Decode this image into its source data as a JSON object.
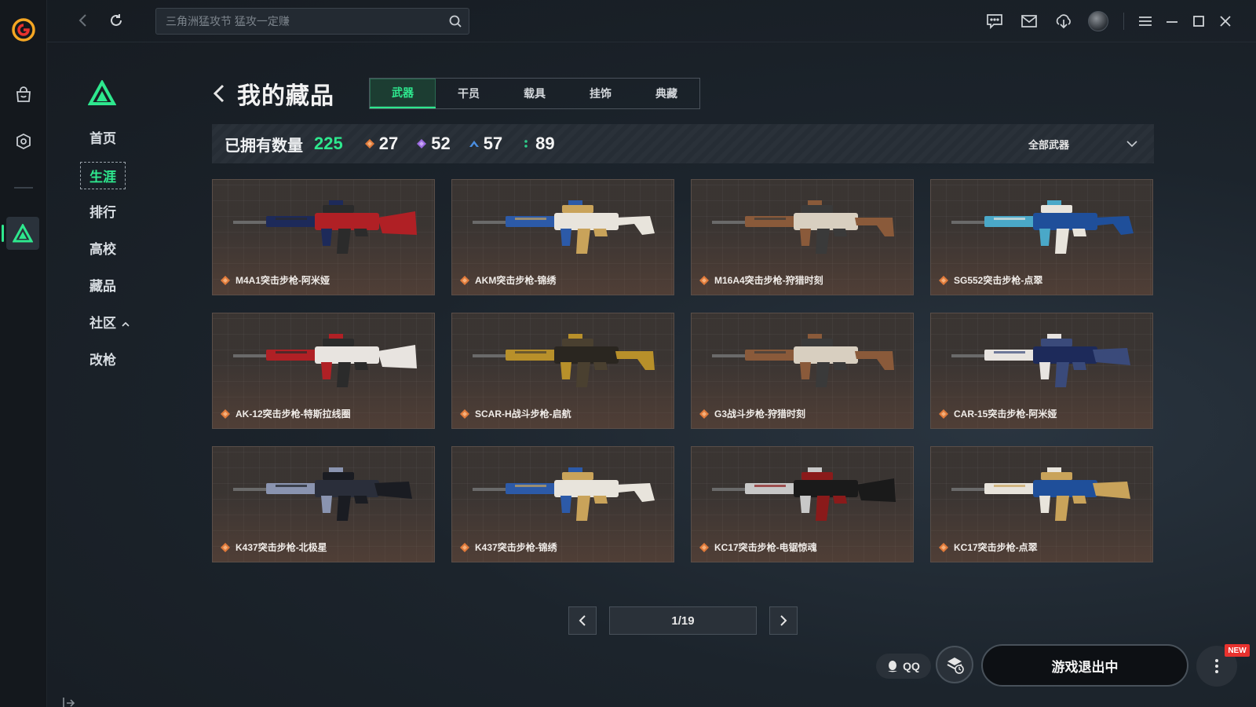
{
  "search": {
    "placeholder": "三角洲猛攻节 猛攻一定赚"
  },
  "subnav": {
    "items": [
      {
        "label": "首页",
        "active": false
      },
      {
        "label": "生涯",
        "active": true
      },
      {
        "label": "排行",
        "active": false
      },
      {
        "label": "高校",
        "active": false
      },
      {
        "label": "藏品",
        "active": false
      },
      {
        "label": "社区",
        "active": false,
        "expandable": true
      },
      {
        "label": "改枪",
        "active": false
      }
    ]
  },
  "page": {
    "title": "我的藏品"
  },
  "tabs": [
    {
      "label": "武器",
      "active": true
    },
    {
      "label": "干员",
      "active": false
    },
    {
      "label": "载具",
      "active": false
    },
    {
      "label": "挂饰",
      "active": false
    },
    {
      "label": "典藏",
      "active": false
    }
  ],
  "stats": {
    "owned_label": "已拥有数量",
    "owned_count": "225",
    "items": [
      {
        "value": "27",
        "color": "#e07a3a"
      },
      {
        "value": "52",
        "color": "#9b6ae0"
      },
      {
        "value": "57",
        "color": "#4a8ee0"
      },
      {
        "value": "89",
        "color": "#2ecc8a"
      }
    ],
    "filter_label": "全部武器"
  },
  "cards": [
    {
      "name": "M4A1突击步枪-阿米娅",
      "palette": [
        "#b02025",
        "#1d2a5a",
        "#2b2b2b"
      ]
    },
    {
      "name": "AKM突击步枪-锦绣",
      "palette": [
        "#e8e4dc",
        "#2c5aa8",
        "#c9a35a"
      ]
    },
    {
      "name": "M16A4突击步枪-狩猎时刻",
      "palette": [
        "#d8cfc0",
        "#8a5a3a",
        "#3a3a3a"
      ]
    },
    {
      "name": "SG552突击步枪-点翠",
      "palette": [
        "#1f4f9a",
        "#4aa8c8",
        "#e8e4dc"
      ]
    },
    {
      "name": "AK-12突击步枪-特斯拉线圈",
      "palette": [
        "#e8e4e0",
        "#b02025",
        "#2b2b2b"
      ]
    },
    {
      "name": "SCAR-H战斗步枪-启航",
      "palette": [
        "#2a2620",
        "#b8902a",
        "#4a4030"
      ]
    },
    {
      "name": "G3战斗步枪-狩猎时刻",
      "palette": [
        "#d8cfc0",
        "#8a5a3a",
        "#3a3a3a"
      ]
    },
    {
      "name": "CAR-15突击步枪-阿米娅",
      "palette": [
        "#1d2a5a",
        "#e8e4e0",
        "#3a4a7a"
      ]
    },
    {
      "name": "K437突击步枪-北极星",
      "palette": [
        "#2a2e3a",
        "#8a94b0",
        "#1a1c22"
      ]
    },
    {
      "name": "K437突击步枪-锦绣",
      "palette": [
        "#e8e4dc",
        "#2c5aa8",
        "#c9a35a"
      ]
    },
    {
      "name": "KC17突击步枪-电锯惊魂",
      "palette": [
        "#1a1a1a",
        "#c8c8c8",
        "#8a1a1a"
      ]
    },
    {
      "name": "KC17突击步枪-点翠",
      "palette": [
        "#1f4f9a",
        "#e8e4dc",
        "#c9a35a"
      ]
    }
  ],
  "pager": {
    "text": "1/19"
  },
  "bottom": {
    "qq_label": "QQ",
    "launch_label": "游戏退出中",
    "new_badge": "NEW"
  },
  "colors": {
    "accent": "#2ee88e",
    "rarity_orange": "#e07a3a"
  },
  "icons": {
    "rail": [
      "app-logo-icon",
      "shopping-bag-icon",
      "tag-icon",
      "delta-force-icon"
    ],
    "top": [
      "chat-icon",
      "mail-icon",
      "download-icon",
      "avatar",
      "menu-icon",
      "minimize-icon",
      "maximize-icon",
      "close-icon"
    ]
  }
}
